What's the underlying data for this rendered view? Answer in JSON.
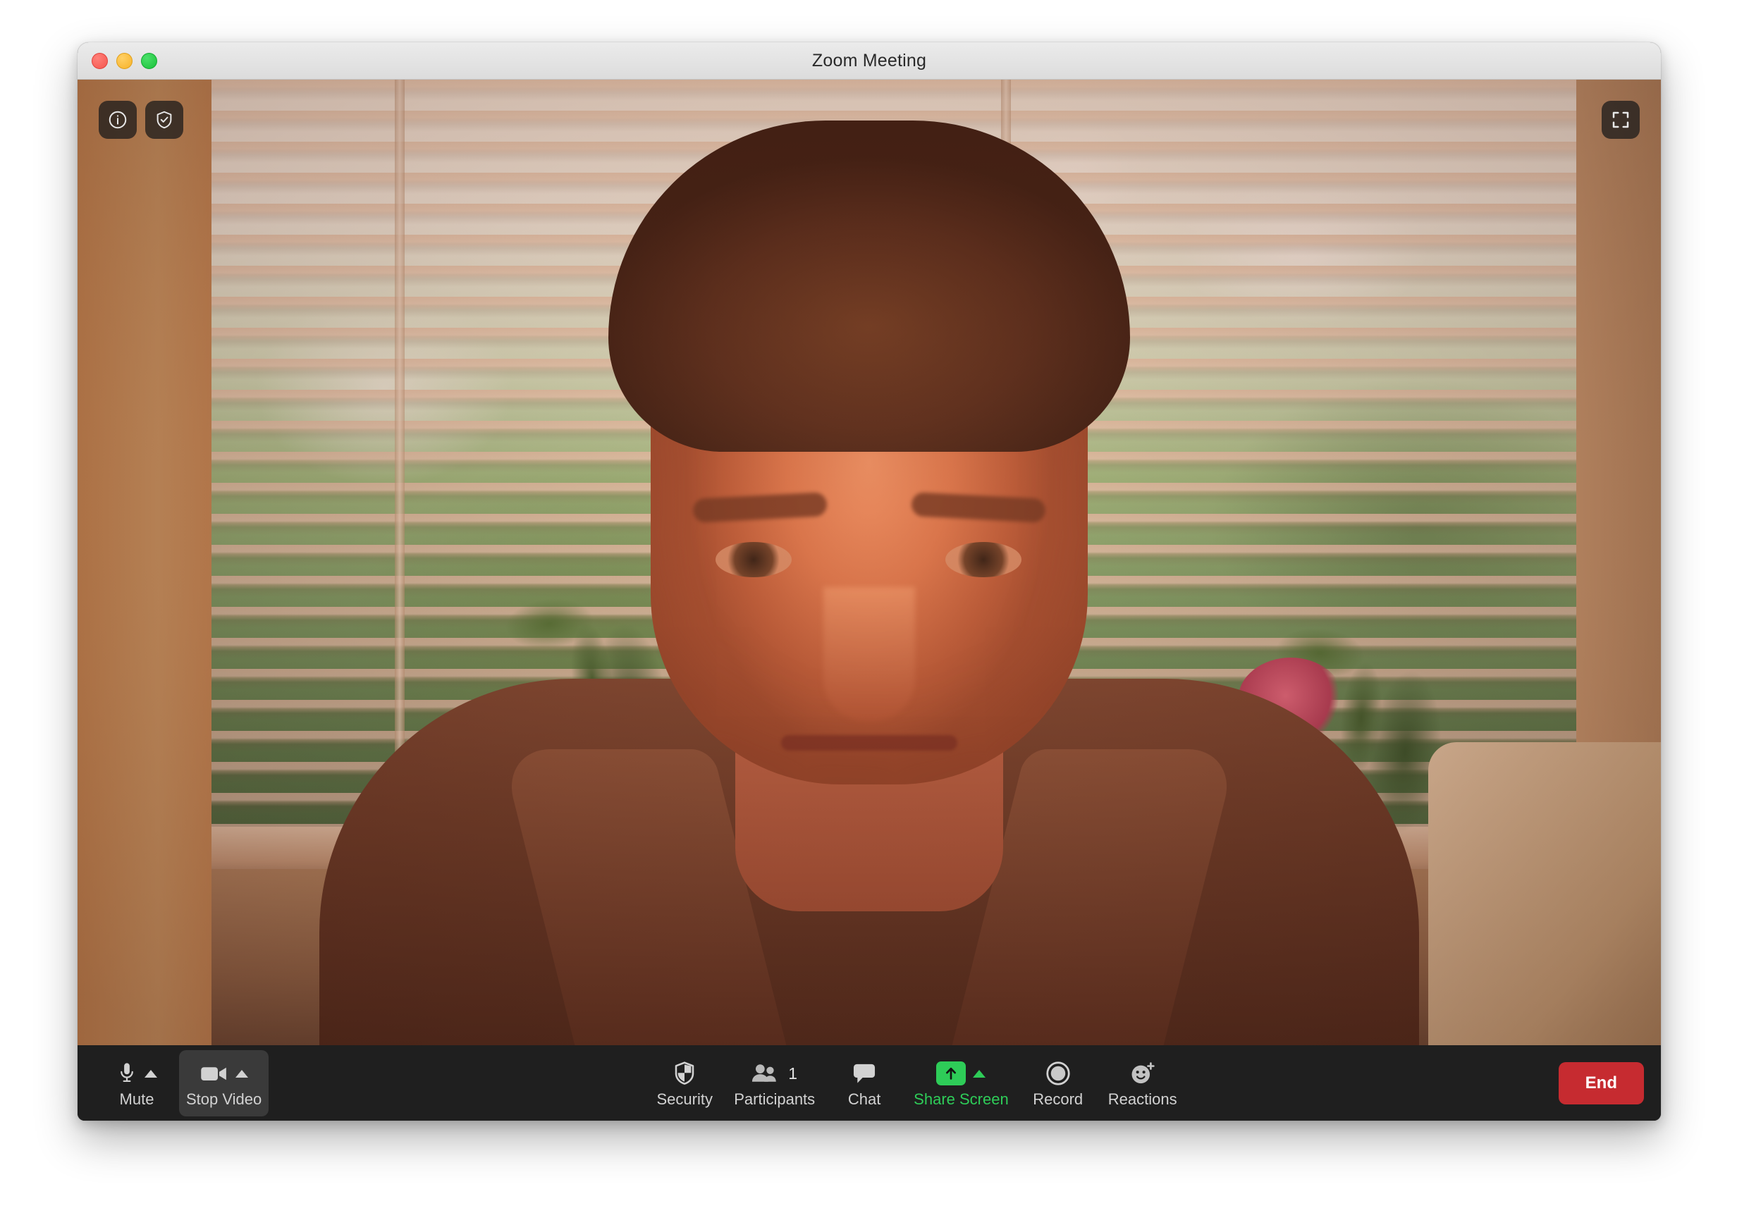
{
  "window": {
    "title": "Zoom Meeting",
    "traffic_lights": [
      {
        "name": "close",
        "color": "#f5564e"
      },
      {
        "name": "minimize",
        "color": "#f7b228"
      },
      {
        "name": "zoom",
        "color": "#19c039"
      }
    ]
  },
  "video_overlay": {
    "info_icon": "info-circle-icon",
    "security_icon": "shield-check-icon",
    "fullscreen_icon": "enter-fullscreen-icon"
  },
  "toolbar": {
    "left": [
      {
        "id": "mute",
        "label": "Mute",
        "icon": "microphone-icon",
        "has_chevron": true,
        "highlighted": false,
        "accent": false
      },
      {
        "id": "stop-video",
        "label": "Stop Video",
        "icon": "video-camera-icon",
        "has_chevron": true,
        "highlighted": true,
        "accent": false
      }
    ],
    "center": [
      {
        "id": "security",
        "label": "Security",
        "icon": "shield-icon",
        "has_chevron": false,
        "badge": "",
        "accent": false
      },
      {
        "id": "participants",
        "label": "Participants",
        "icon": "people-icon",
        "has_chevron": false,
        "badge": "1",
        "accent": false
      },
      {
        "id": "chat",
        "label": "Chat",
        "icon": "speech-bubble-icon",
        "has_chevron": false,
        "badge": "",
        "accent": false
      },
      {
        "id": "share-screen",
        "label": "Share Screen",
        "icon": "share-screen-up-arrow-icon",
        "has_chevron": true,
        "badge": "",
        "accent": true
      },
      {
        "id": "record",
        "label": "Record",
        "icon": "record-circle-icon",
        "has_chevron": false,
        "badge": "",
        "accent": false
      },
      {
        "id": "reactions",
        "label": "Reactions",
        "icon": "smiley-plus-icon",
        "has_chevron": false,
        "badge": "",
        "accent": false
      }
    ],
    "end_button": {
      "label": "End",
      "color": "#c62b30"
    }
  },
  "colors": {
    "toolbar_bg": "#1f1f1f",
    "accent_green": "#2ecc58",
    "end_red": "#c62b30",
    "label_gray": "#d2d2d2",
    "titlebar_bg": "#e3e3e3"
  }
}
